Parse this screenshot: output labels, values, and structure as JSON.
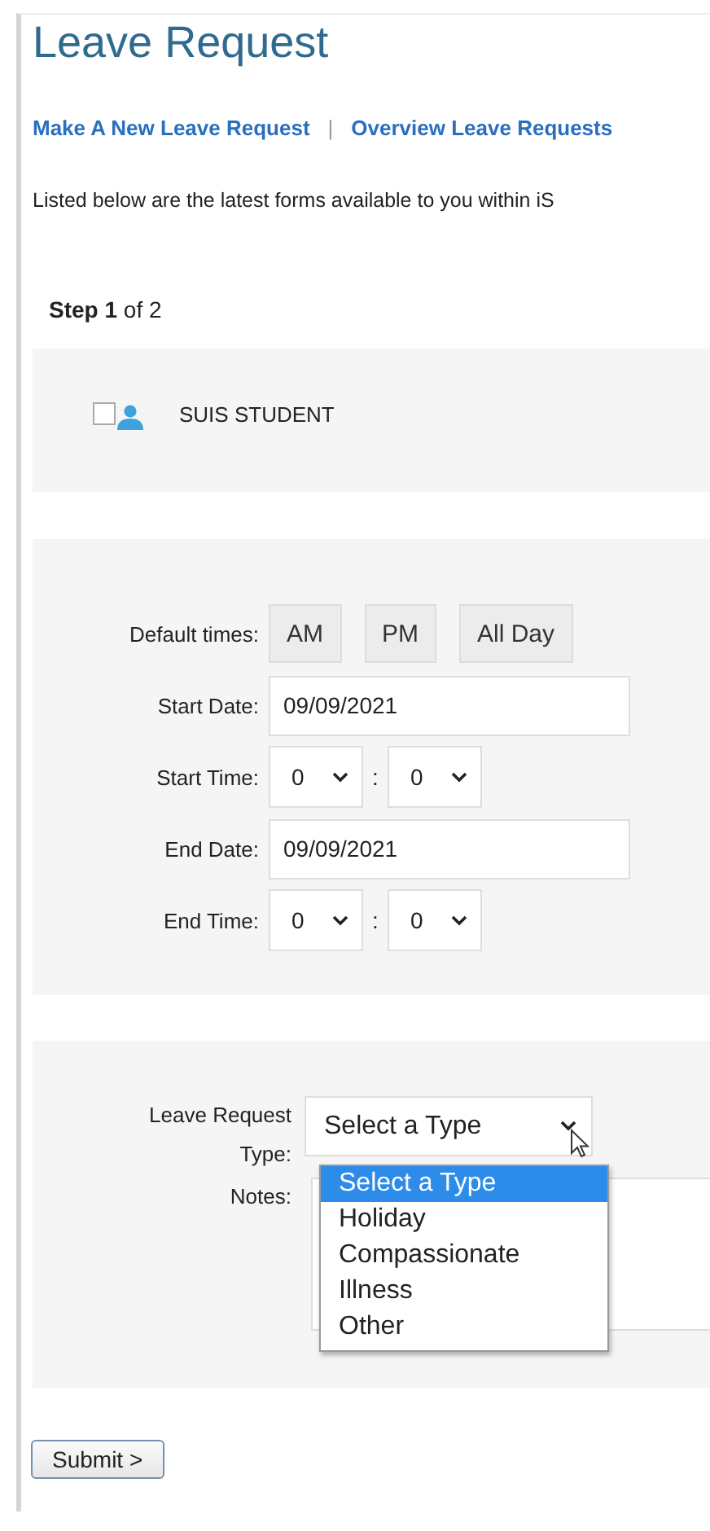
{
  "title": "Leave Request",
  "nav_links": [
    {
      "label": "Make A New Leave Request"
    },
    {
      "label": "Overview Leave Requests"
    }
  ],
  "nav_separator": "|",
  "intro": "Listed below are the latest forms available to you within iS",
  "step": "**Step 1** of 2",
  "recipient": {
    "name": "SUIS STUDENT",
    "checked": false
  },
  "default_times": {
    "label": "Default times:",
    "buttons": [
      "AM",
      "PM",
      "All Day"
    ]
  },
  "fields": [
    {
      "kind": "date",
      "label": "Start Date:",
      "value": "09/09/2021"
    },
    {
      "kind": "time",
      "label": "Start Time:",
      "hour": "0",
      "separator": ":",
      "minute": "0"
    },
    {
      "kind": "date",
      "label": "End Date:",
      "value": "09/09/2021"
    },
    {
      "kind": "time",
      "label": "End Time:",
      "hour": "0",
      "separator": ":",
      "minute": "0"
    }
  ],
  "leave_type": {
    "label": "Leave Request Type:",
    "value": "Select a Type",
    "expanded": true,
    "options": [
      {
        "label": "Select a Type",
        "selected": true
      },
      {
        "label": "Holiday",
        "selected": false
      },
      {
        "label": "Compassionate",
        "selected": false
      },
      {
        "label": "Illness",
        "selected": false
      },
      {
        "label": "Other",
        "selected": false
      }
    ]
  },
  "notes": {
    "label": "Notes:"
  },
  "submit": "Submit >"
}
